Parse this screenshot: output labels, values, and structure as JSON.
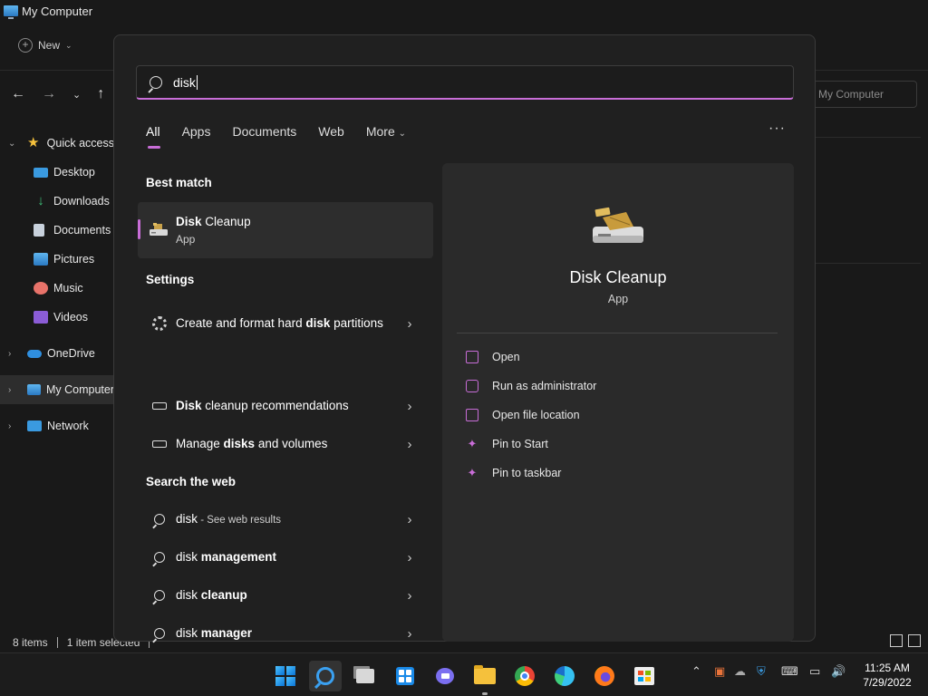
{
  "explorer": {
    "title": "My Computer",
    "toolbar_new": "New",
    "address_text": "My Computer",
    "nav": {
      "quick_access": "Quick access",
      "desktop": "Desktop",
      "downloads": "Downloads",
      "documents": "Documents",
      "pictures": "Pictures",
      "music": "Music",
      "videos": "Videos",
      "onedrive": "OneDrive",
      "my_computer": "My Computer",
      "network": "Network"
    },
    "status": {
      "items": "8 items",
      "selected": "1 item selected"
    }
  },
  "search": {
    "query": "disk",
    "tabs": [
      "All",
      "Apps",
      "Documents",
      "Web",
      "More"
    ],
    "active_tab": "All",
    "sections": {
      "best_match": "Best match",
      "settings": "Settings",
      "web": "Search the web"
    },
    "best_match": {
      "bold": "Disk",
      "rest": " Cleanup",
      "type": "App"
    },
    "settings_results": [
      {
        "pre": "Create and format hard ",
        "bold": "disk",
        "post": " partitions"
      },
      {
        "pre": "",
        "bold": "Disk",
        "post": " cleanup recommendations"
      },
      {
        "pre": "Manage ",
        "bold": "disks",
        "post": " and volumes"
      }
    ],
    "web_results": [
      {
        "text": "disk",
        "suffix": " - See web results"
      },
      {
        "text": "disk ",
        "bold": "management"
      },
      {
        "text": "disk ",
        "bold": "cleanup"
      },
      {
        "text": "disk ",
        "bold": "manager"
      }
    ],
    "detail": {
      "title": "Disk Cleanup",
      "subtitle": "App",
      "actions": [
        "Open",
        "Run as administrator",
        "Open file location",
        "Pin to Start",
        "Pin to taskbar"
      ]
    },
    "accent": "#c86dd7"
  },
  "taskbar": {
    "time": "11:25 AM",
    "date": "7/29/2022"
  }
}
